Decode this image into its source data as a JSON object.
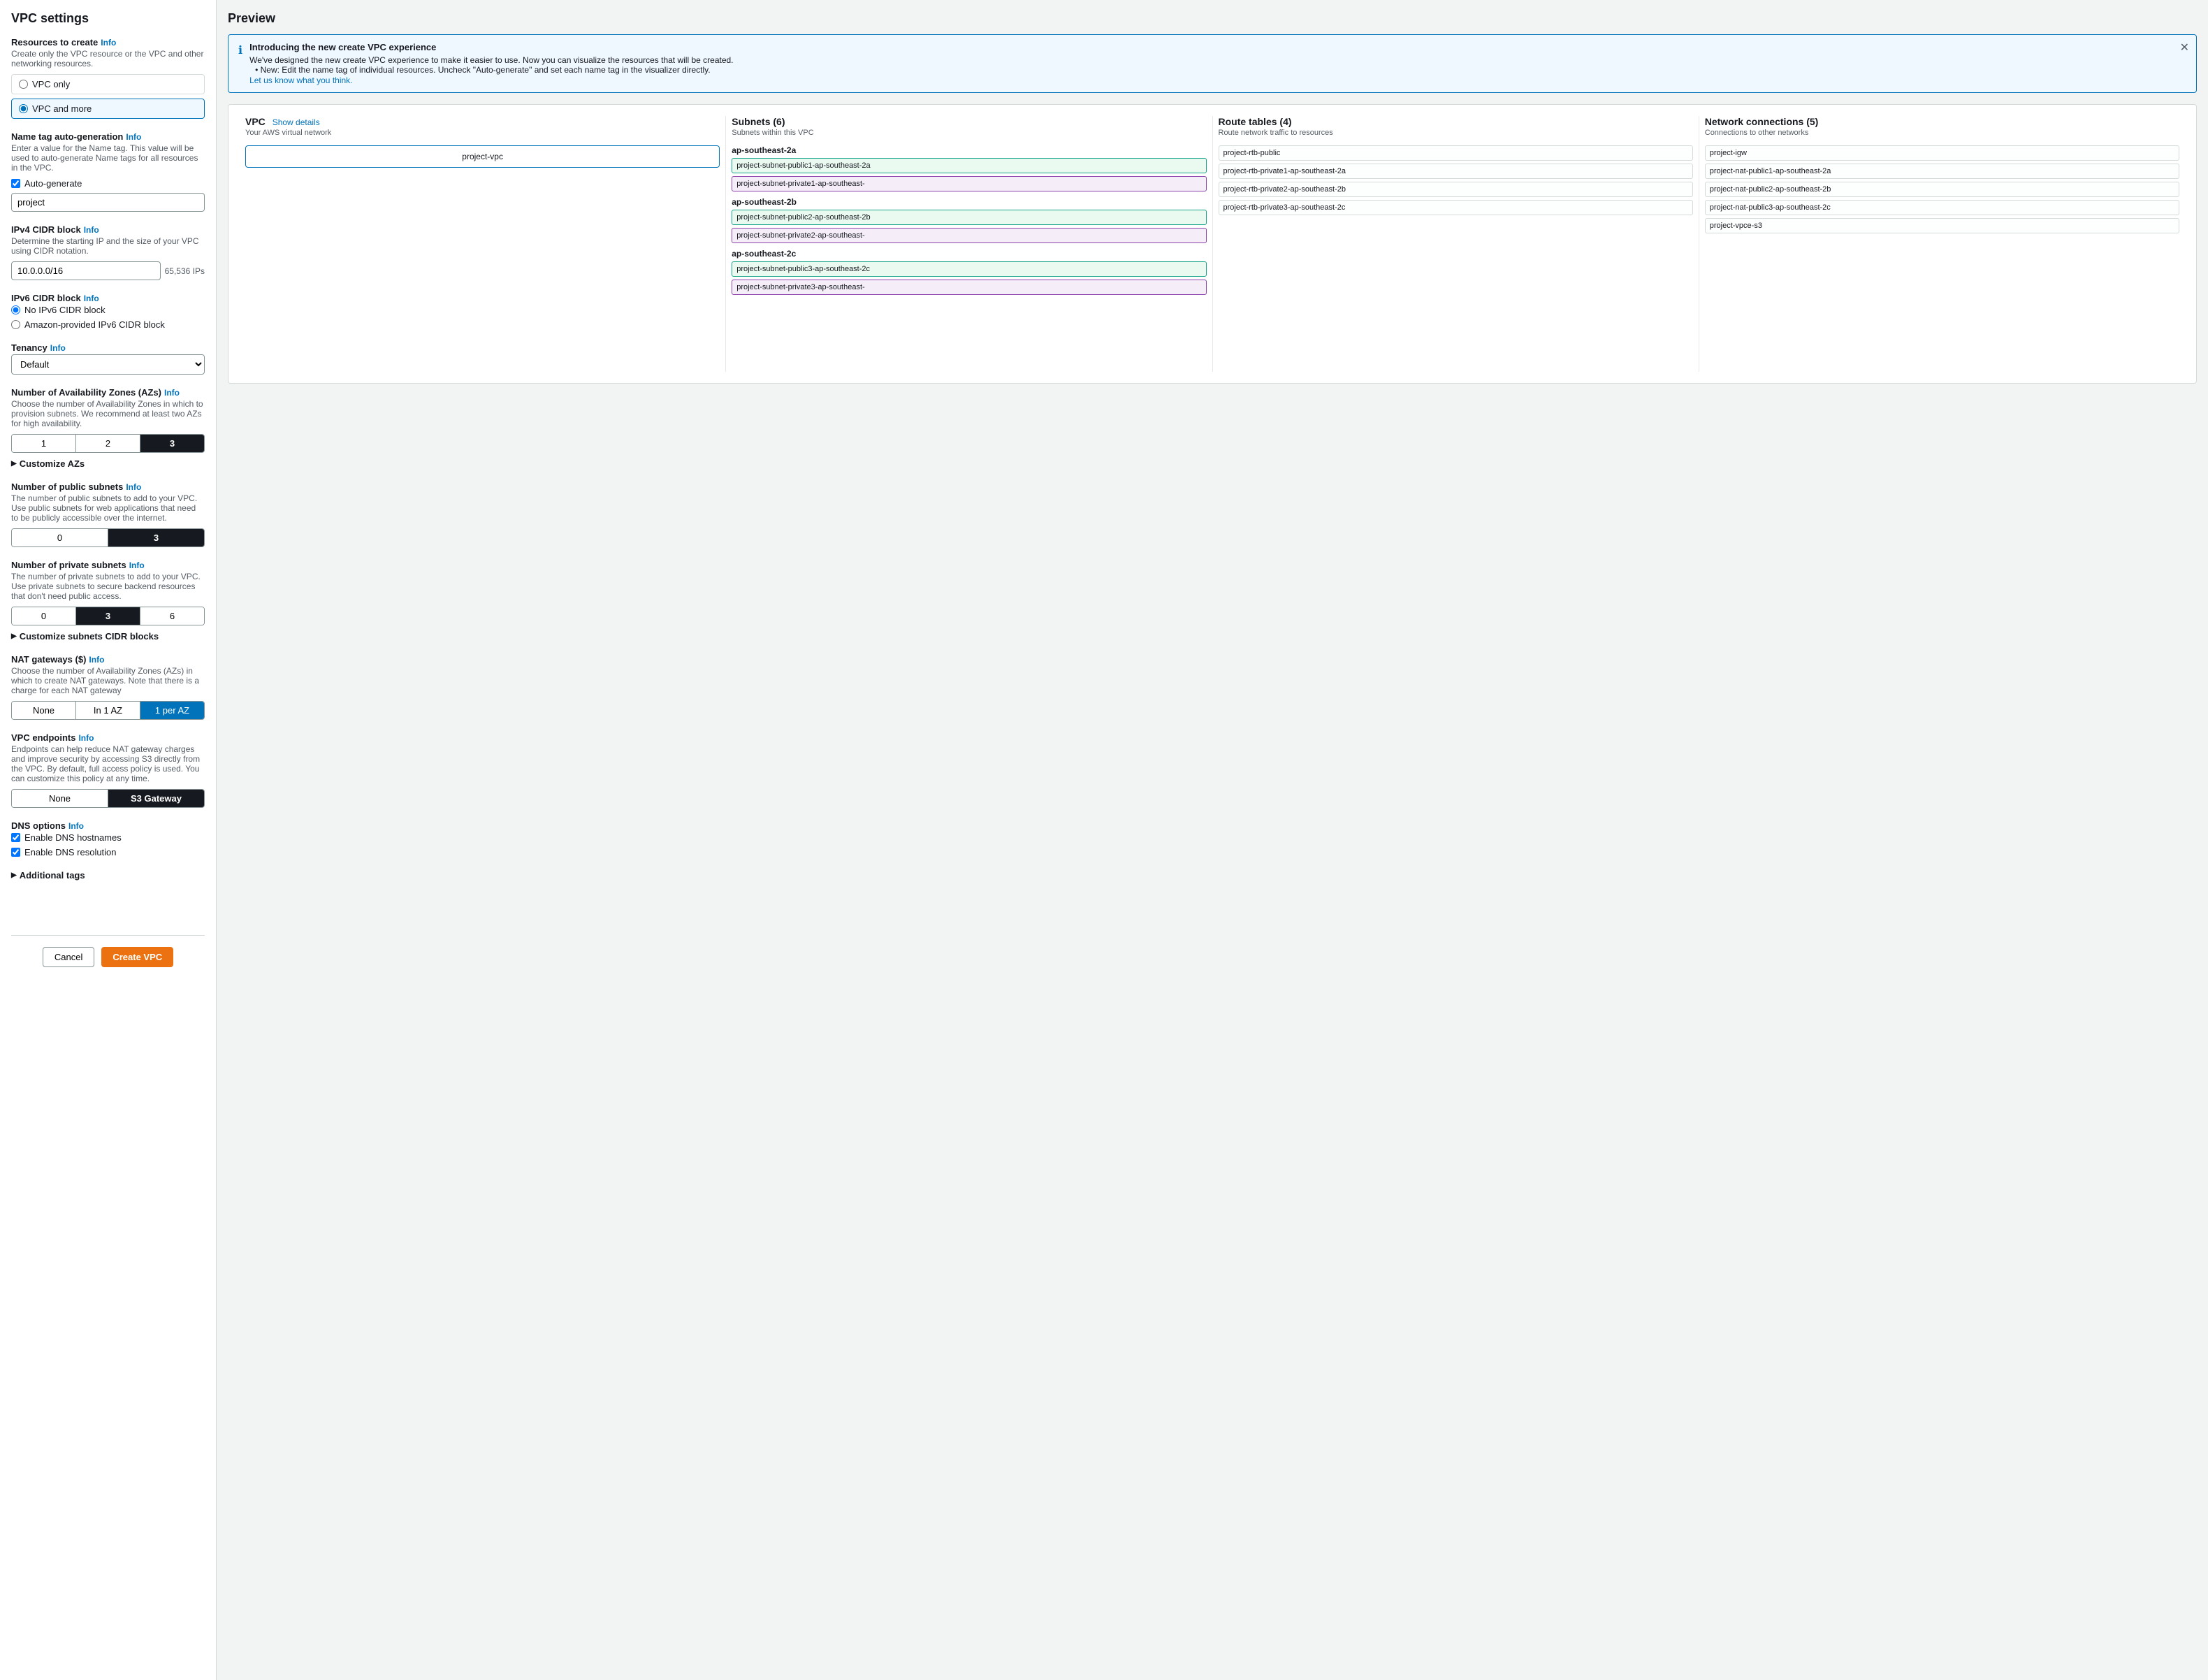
{
  "leftPanel": {
    "title": "VPC settings",
    "resourcesSection": {
      "label": "Resources to create",
      "infoLink": "Info",
      "desc": "Create only the VPC resource or the VPC and other networking resources.",
      "options": [
        {
          "id": "vpc-only",
          "label": "VPC only",
          "selected": false
        },
        {
          "id": "vpc-and-more",
          "label": "VPC and more",
          "selected": true
        }
      ]
    },
    "nameTagSection": {
      "label": "Name tag auto-generation",
      "infoLink": "Info",
      "desc": "Enter a value for the Name tag. This value will be used to auto-generate Name tags for all resources in the VPC.",
      "checkboxLabel": "Auto-generate",
      "checked": true,
      "inputValue": "project"
    },
    "ipv4Section": {
      "label": "IPv4 CIDR block",
      "infoLink": "Info",
      "desc": "Determine the starting IP and the size of your VPC using CIDR notation.",
      "value": "10.0.0.0/16",
      "suffix": "65,536 IPs"
    },
    "ipv6Section": {
      "label": "IPv6 CIDR block",
      "infoLink": "Info",
      "options": [
        {
          "id": "no-ipv6",
          "label": "No IPv6 CIDR block",
          "selected": true
        },
        {
          "id": "amazon-ipv6",
          "label": "Amazon-provided IPv6 CIDR block",
          "selected": false
        }
      ]
    },
    "tenancySection": {
      "label": "Tenancy",
      "infoLink": "Info",
      "value": "Default"
    },
    "azSection": {
      "label": "Number of Availability Zones (AZs)",
      "infoLink": "Info",
      "desc": "Choose the number of Availability Zones in which to provision subnets. We recommend at least two AZs for high availability.",
      "options": [
        "1",
        "2",
        "3"
      ],
      "selected": 2,
      "customizeLabel": "Customize AZs"
    },
    "publicSubnetsSection": {
      "label": "Number of public subnets",
      "infoLink": "Info",
      "desc": "The number of public subnets to add to your VPC. Use public subnets for web applications that need to be publicly accessible over the internet.",
      "options": [
        "0",
        "3"
      ],
      "selected": 1
    },
    "privateSubnetsSection": {
      "label": "Number of private subnets",
      "infoLink": "Info",
      "desc": "The number of private subnets to add to your VPC. Use private subnets to secure backend resources that don't need public access.",
      "options": [
        "0",
        "3",
        "6"
      ],
      "selected": 1,
      "customizeLabel": "Customize subnets CIDR blocks"
    },
    "natSection": {
      "label": "NAT gateways ($)",
      "infoLink": "Info",
      "desc": "Choose the number of Availability Zones (AZs) in which to create NAT gateways. Note that there is a charge for each NAT gateway",
      "options": [
        "None",
        "In 1 AZ",
        "1 per AZ"
      ],
      "selected": 2
    },
    "endpointsSection": {
      "label": "VPC endpoints",
      "infoLink": "Info",
      "desc": "Endpoints can help reduce NAT gateway charges and improve security by accessing S3 directly from the VPC. By default, full access policy is used. You can customize this policy at any time.",
      "options": [
        "None",
        "S3 Gateway"
      ],
      "selected": 1
    },
    "dnsSection": {
      "label": "DNS options",
      "infoLink": "Info",
      "options": [
        {
          "label": "Enable DNS hostnames",
          "checked": true
        },
        {
          "label": "Enable DNS resolution",
          "checked": true
        }
      ]
    },
    "additionalTags": {
      "label": "Additional tags"
    },
    "footer": {
      "cancelLabel": "Cancel",
      "createLabel": "Create VPC"
    }
  },
  "rightPanel": {
    "title": "Preview",
    "infoBanner": {
      "title": "Introducing the new create VPC experience",
      "desc": "We've designed the new create VPC experience to make it easier to use. Now you can visualize the resources that will be created.",
      "bullet": "New: Edit the name tag of individual resources. Uncheck \"Auto-generate\" and set each name tag in the visualizer directly.",
      "link": "Let us know what you think."
    },
    "diagram": {
      "columns": [
        {
          "id": "vpc",
          "title": "VPC",
          "showDetails": "Show details",
          "subtitle": "Your AWS virtual network",
          "vpcName": "project-vpc"
        },
        {
          "id": "subnets",
          "title": "Subnets (6)",
          "subtitle": "Subnets within this VPC",
          "azGroups": [
            {
              "az": "ap-southeast-2a",
              "subnets": [
                {
                  "name": "project-subnet-public1-ap-southeast-2a",
                  "type": "public"
                },
                {
                  "name": "project-subnet-private1-ap-southeast-",
                  "type": "private"
                }
              ]
            },
            {
              "az": "ap-southeast-2b",
              "subnets": [
                {
                  "name": "project-subnet-public2-ap-southeast-2b",
                  "type": "public"
                },
                {
                  "name": "project-subnet-private2-ap-southeast-",
                  "type": "private"
                }
              ]
            },
            {
              "az": "ap-southeast-2c",
              "subnets": [
                {
                  "name": "project-subnet-public3-ap-southeast-2c",
                  "type": "public"
                },
                {
                  "name": "project-subnet-private3-ap-southeast-",
                  "type": "private"
                }
              ]
            }
          ]
        },
        {
          "id": "route-tables",
          "title": "Route tables (4)",
          "subtitle": "Route network traffic to resources",
          "items": [
            "project-rtb-public",
            "project-rtb-private1-ap-southeast-2a",
            "project-rtb-private2-ap-southeast-2b",
            "project-rtb-private3-ap-southeast-2c"
          ]
        },
        {
          "id": "network-connections",
          "title": "Network connections (5)",
          "subtitle": "Connections to other networks",
          "items": [
            "project-igw",
            "project-nat-public1-ap-southeast-2a",
            "project-nat-public2-ap-southeast-2b",
            "project-nat-public3-ap-southeast-2c",
            "project-vpce-s3"
          ]
        }
      ]
    }
  }
}
